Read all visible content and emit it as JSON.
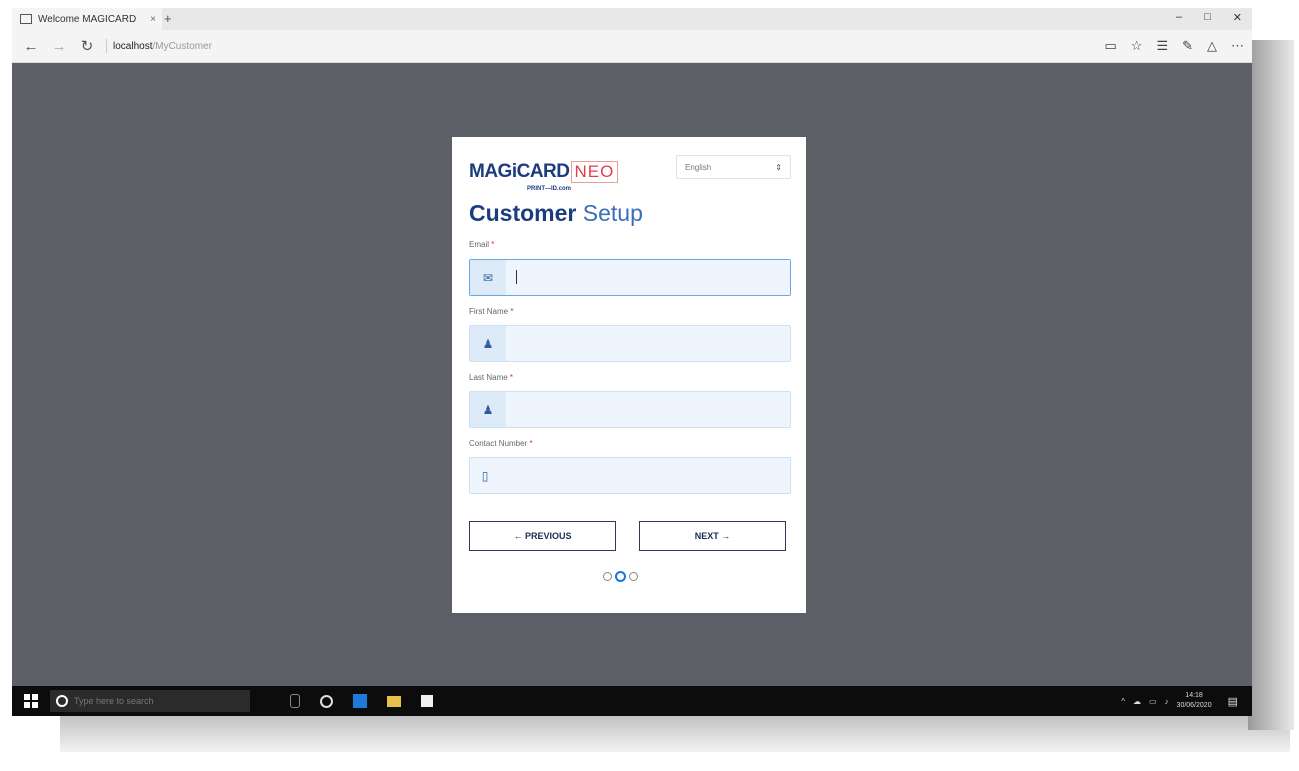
{
  "browser": {
    "tab_title": "Welcome MAGICARD",
    "tab_close": "×",
    "new_tab": "+",
    "minimize": "–",
    "maximize": "□",
    "close": "✕",
    "url_host": "localhost",
    "url_path": "/MyCustomer"
  },
  "form": {
    "logo_primary": "MAGiCARD",
    "logo_secondary": "NEO",
    "logo_tagline": "PRINT—ID.com",
    "language_selected": "English",
    "title_bold": "Customer",
    "title_light": "Setup",
    "fields": [
      {
        "label": "Email",
        "required": "*",
        "value": ""
      },
      {
        "label": "First Name",
        "required": "*",
        "value": ""
      },
      {
        "label": "Last Name",
        "required": "*",
        "value": ""
      },
      {
        "label": "Contact Number",
        "required": "*",
        "value": ""
      }
    ],
    "previous_label": "← PREVIOUS",
    "next_label": "NEXT →",
    "steps_total": 3,
    "current_step": 2
  },
  "taskbar": {
    "search_placeholder": "Type here to search",
    "time": "14:18",
    "date": "30/06/2020"
  },
  "colors": {
    "backdrop": "#5d5f66",
    "brand_navy": "#1c3c80",
    "brand_red": "#e43c4d",
    "field_tint": "#eef5fc",
    "active_step": "#1a73e8"
  }
}
